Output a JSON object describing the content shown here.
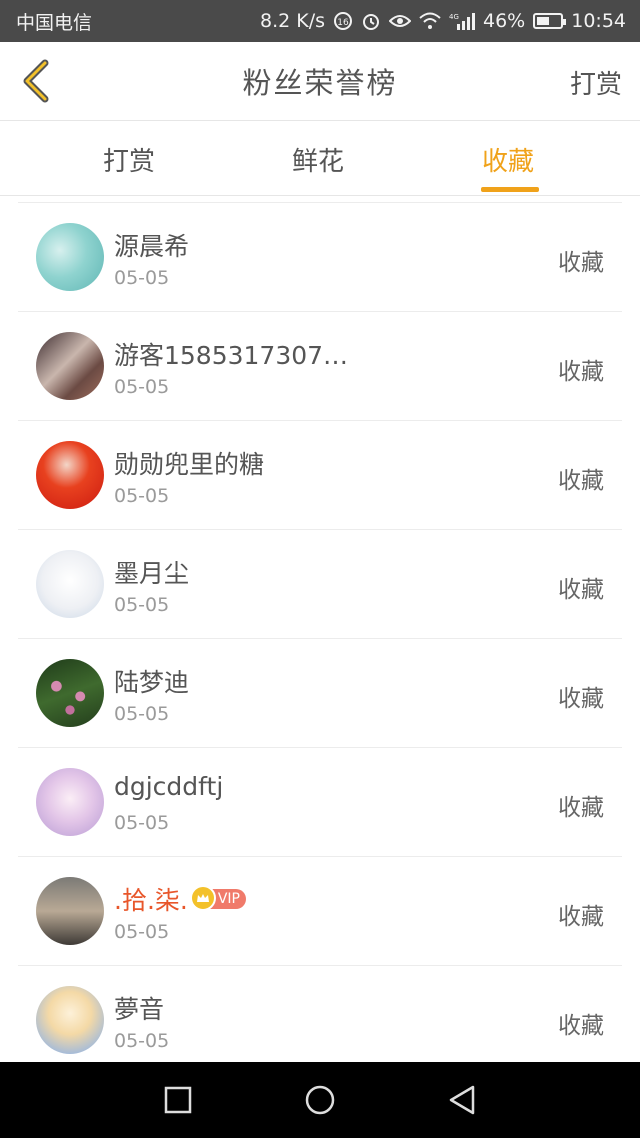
{
  "status_bar": {
    "carrier": "中国电信",
    "speed": "8.2 K/s",
    "network": "4G",
    "battery": "46%",
    "time": "10:54"
  },
  "header": {
    "title": "粉丝荣誉榜",
    "right_action": "打赏"
  },
  "tabs": [
    {
      "label": "打赏",
      "active": false
    },
    {
      "label": "鲜花",
      "active": false
    },
    {
      "label": "收藏",
      "active": true
    }
  ],
  "fans": [
    {
      "name": "源晨希",
      "date": "05-05",
      "action": "收藏",
      "vip": false
    },
    {
      "name": "游客1585317307…",
      "date": "05-05",
      "action": "收藏",
      "vip": false
    },
    {
      "name": "勋勋兜里的糖",
      "date": "05-05",
      "action": "收藏",
      "vip": false
    },
    {
      "name": "墨月尘",
      "date": "05-05",
      "action": "收藏",
      "vip": false
    },
    {
      "name": "陆梦迪",
      "date": "05-05",
      "action": "收藏",
      "vip": false
    },
    {
      "name": "dgjcddftj",
      "date": "05-05",
      "action": "收藏",
      "vip": false
    },
    {
      "name": ".拾.柒.",
      "date": "05-05",
      "action": "收藏",
      "vip": true,
      "badge": "VIP"
    },
    {
      "name": "夢音",
      "date": "05-05",
      "action": "收藏",
      "vip": false
    }
  ],
  "colors": {
    "accent": "#f0a21a",
    "vip_name": "#e8562a",
    "status_bar_bg": "#4a4a4a",
    "nav_bar_bg": "#000000"
  },
  "icons": {
    "back": "chevron-left-icon",
    "nav_recent": "square-icon",
    "nav_home": "circle-icon",
    "nav_back": "triangle-left-icon"
  }
}
